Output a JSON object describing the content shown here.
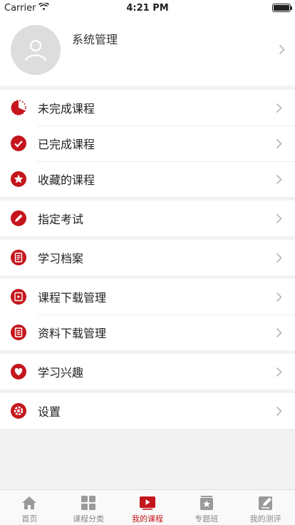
{
  "status_bar": {
    "carrier": "Carrier",
    "time": "4:21 PM"
  },
  "profile": {
    "name": "系统管理"
  },
  "menu": {
    "groups": [
      {
        "items": [
          {
            "label": "未完成课程",
            "icon": "pie-half-icon"
          },
          {
            "label": "已完成课程",
            "icon": "check-circle-icon"
          },
          {
            "label": "收藏的课程",
            "icon": "star-circle-icon"
          }
        ]
      },
      {
        "items": [
          {
            "label": "指定考试",
            "icon": "pencil-circle-icon"
          }
        ]
      },
      {
        "items": [
          {
            "label": "学习档案",
            "icon": "document-icon"
          }
        ]
      },
      {
        "items": [
          {
            "label": "课程下载管理",
            "icon": "video-download-icon"
          },
          {
            "label": "资料下载管理",
            "icon": "file-download-icon"
          }
        ]
      },
      {
        "items": [
          {
            "label": "学习兴趣",
            "icon": "heart-circle-icon"
          }
        ]
      },
      {
        "items": [
          {
            "label": "设置",
            "icon": "settings-gear-icon"
          }
        ]
      }
    ]
  },
  "tabbar": {
    "tabs": [
      {
        "label": "首页",
        "icon": "home-icon"
      },
      {
        "label": "课程分类",
        "icon": "grid-icon"
      },
      {
        "label": "我的课程",
        "icon": "play-icon",
        "active": true
      },
      {
        "label": "专题班",
        "icon": "badge-star-icon"
      },
      {
        "label": "我的测评",
        "icon": "note-edit-icon"
      }
    ]
  },
  "colors": {
    "accent": "#c4161c",
    "inactive": "#888888",
    "background": "#f2f2f2"
  }
}
